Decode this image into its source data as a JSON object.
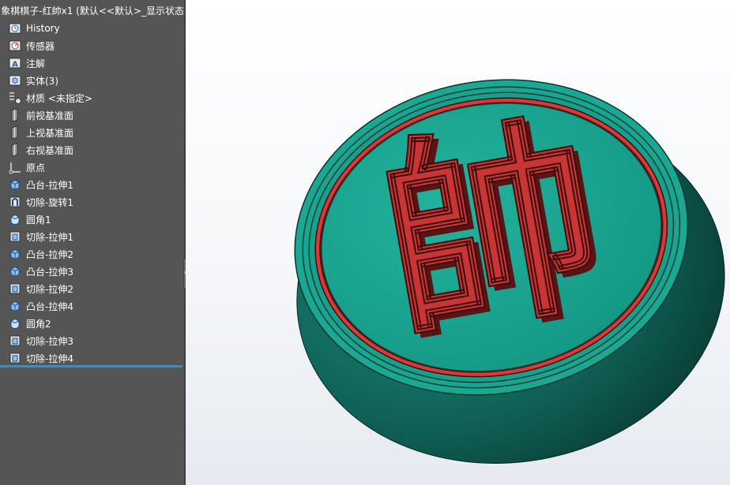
{
  "tree": {
    "root_label": "象棋棋子-红帥x1  (默认<<默认>_显示状态",
    "items": [
      {
        "label": "History",
        "icon": "history-icon"
      },
      {
        "label": "传感器",
        "icon": "sensor-icon"
      },
      {
        "label": "注解",
        "icon": "annotation-icon"
      },
      {
        "label": "实体(3)",
        "icon": "solid-bodies-icon"
      },
      {
        "label": "材质 <未指定>",
        "icon": "material-icon"
      },
      {
        "label": "前视基准面",
        "icon": "plane-icon"
      },
      {
        "label": "上视基准面",
        "icon": "plane-icon"
      },
      {
        "label": "右视基准面",
        "icon": "plane-icon"
      },
      {
        "label": "原点",
        "icon": "origin-icon"
      },
      {
        "label": "凸台-拉伸1",
        "icon": "boss-extrude-icon"
      },
      {
        "label": "切除-旋转1",
        "icon": "cut-revolve-icon"
      },
      {
        "label": "圆角1",
        "icon": "fillet-icon"
      },
      {
        "label": "切除-拉伸1",
        "icon": "cut-extrude-icon"
      },
      {
        "label": "凸台-拉伸2",
        "icon": "boss-extrude-icon"
      },
      {
        "label": "凸台-拉伸3",
        "icon": "boss-extrude-icon"
      },
      {
        "label": "切除-拉伸2",
        "icon": "cut-extrude-icon"
      },
      {
        "label": "凸台-拉伸4",
        "icon": "boss-extrude-icon"
      },
      {
        "label": "圆角2",
        "icon": "fillet-icon"
      },
      {
        "label": "切除-拉伸3",
        "icon": "cut-extrude-icon"
      },
      {
        "label": "切除-拉伸4",
        "icon": "cut-extrude-icon"
      }
    ]
  },
  "model": {
    "character": "帥",
    "colors": {
      "piece_green": "#1aaa96",
      "piece_dark": "#0f5a4f",
      "ring_red": "#d63b3b",
      "char_red": "#c93434",
      "char_shadow": "#5a1414",
      "panel_bg": "#555555",
      "selection_line": "#2f8fd6"
    }
  }
}
